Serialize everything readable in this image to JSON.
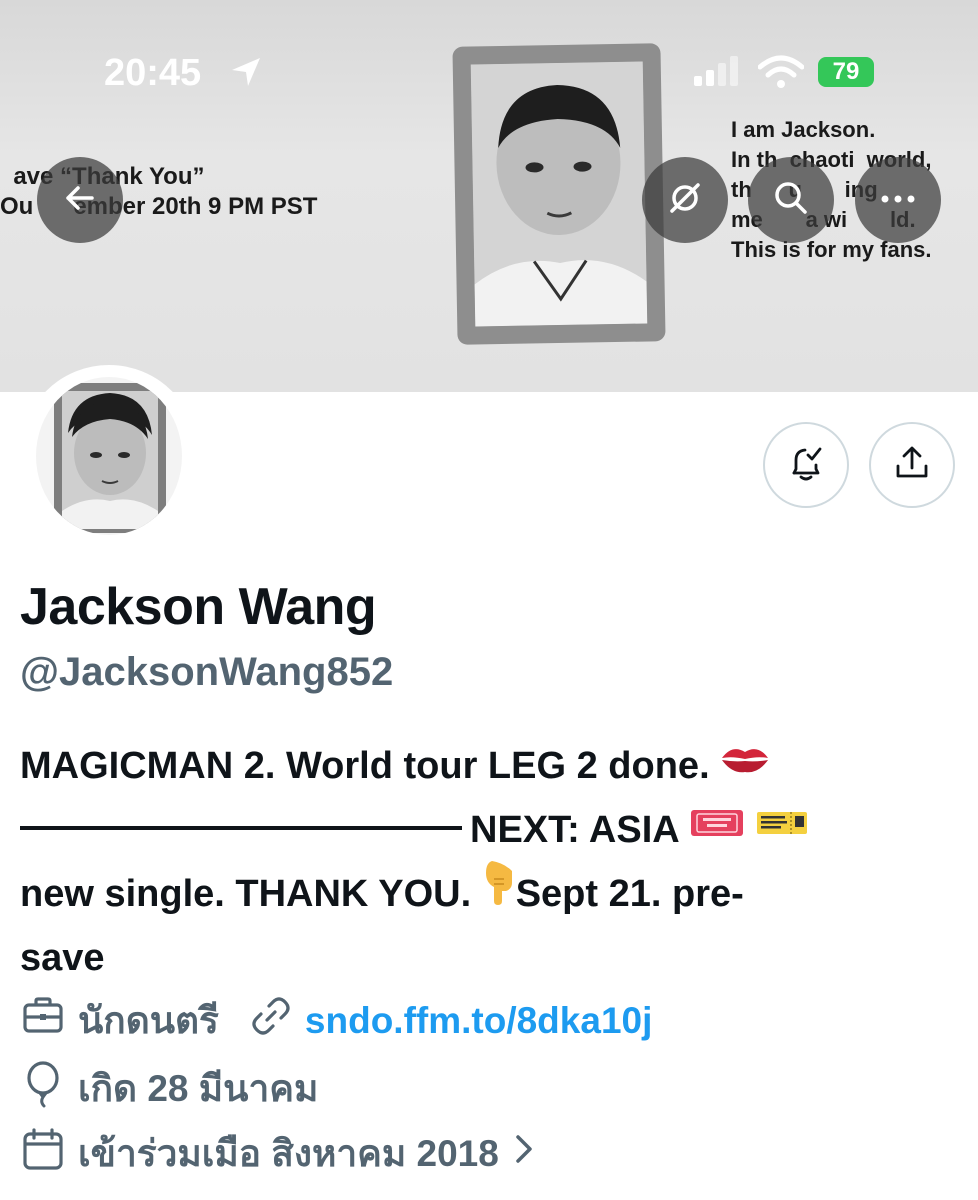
{
  "status_bar": {
    "time": "20:45",
    "battery": "79"
  },
  "banner": {
    "left_lines": "  ave “Thank You”\nOu      ember 20th 9 PM PST",
    "right_lines": "I am Jackson.\nIn th  chaoti  world,\nth      u       ing\nme       a wi       ld.\nThis is for my fans."
  },
  "profile": {
    "name": "Jackson Wang",
    "handle": "@JacksonWang852",
    "bio_line1": "MAGICMAN 2. World tour LEG 2 done.",
    "bio_line2": "NEXT: ASIA",
    "bio_line3": "new single. THANK YOU.",
    "bio_line3b": "Sept 21. pre-",
    "bio_line4": "save",
    "profession": "นักดนตรี",
    "link": "sndo.ffm.to/8dka10j",
    "birthday": "เกิด 28 มีนาคม",
    "joined": "เข้าร่วมเมือ สิงหาคม 2018"
  },
  "icons": {
    "back": "arrow-left-icon",
    "translate": "slash-circle-icon",
    "search": "search-icon",
    "more": "more-icon",
    "bell": "notification-bell-icon",
    "share": "share-icon"
  },
  "colors": {
    "link": "#1d9bf0",
    "secondary": "#536471",
    "battery": "#34c759"
  }
}
